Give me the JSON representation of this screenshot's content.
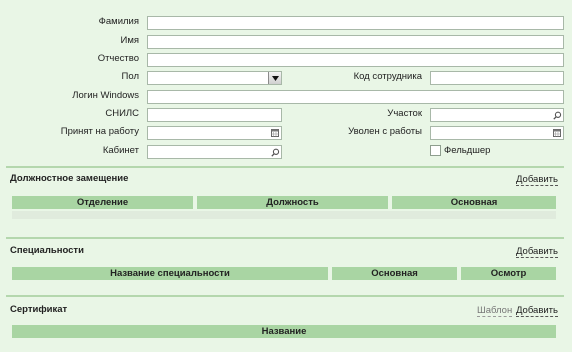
{
  "form": {
    "surname_label": "Фамилия",
    "surname_value": "",
    "name_label": "Имя",
    "name_value": "",
    "patronymic_label": "Отчество",
    "patronymic_value": "",
    "sex_label": "Пол",
    "sex_value": "",
    "employee_code_label": "Код сотрудника",
    "employee_code_value": "",
    "windows_login_label": "Логин Windows",
    "windows_login_value": "",
    "snils_label": "СНИЛС",
    "snils_value": "",
    "district_label": "Участок",
    "district_value": "",
    "hired_label": "Принят на работу",
    "hired_value": "",
    "fired_label": "Уволен с работы",
    "fired_value": "",
    "office_label": "Кабинет",
    "office_value": "",
    "paramedic_label": "Фельдшер",
    "paramedic_checked": false
  },
  "positions": {
    "title": "Должностное замещение",
    "add_label": "Добавить",
    "columns": [
      "Отделение",
      "Должность",
      "Основная"
    ]
  },
  "specialties": {
    "title": "Специальности",
    "add_label": "Добавить",
    "columns": [
      "Название специальности",
      "Основная",
      "Осмотр"
    ]
  },
  "certificate": {
    "title": "Сертификат",
    "template_label": "Шаблон",
    "add_label": "Добавить",
    "columns": [
      "Название"
    ]
  },
  "icons": {
    "search": "magnifier-icon",
    "calendar": "calendar-icon",
    "dropdown": "triangle-down-icon"
  },
  "colors": {
    "background": "#e9f6e6",
    "header_fill": "#a9d5a3",
    "separator": "#b4d7ad"
  }
}
